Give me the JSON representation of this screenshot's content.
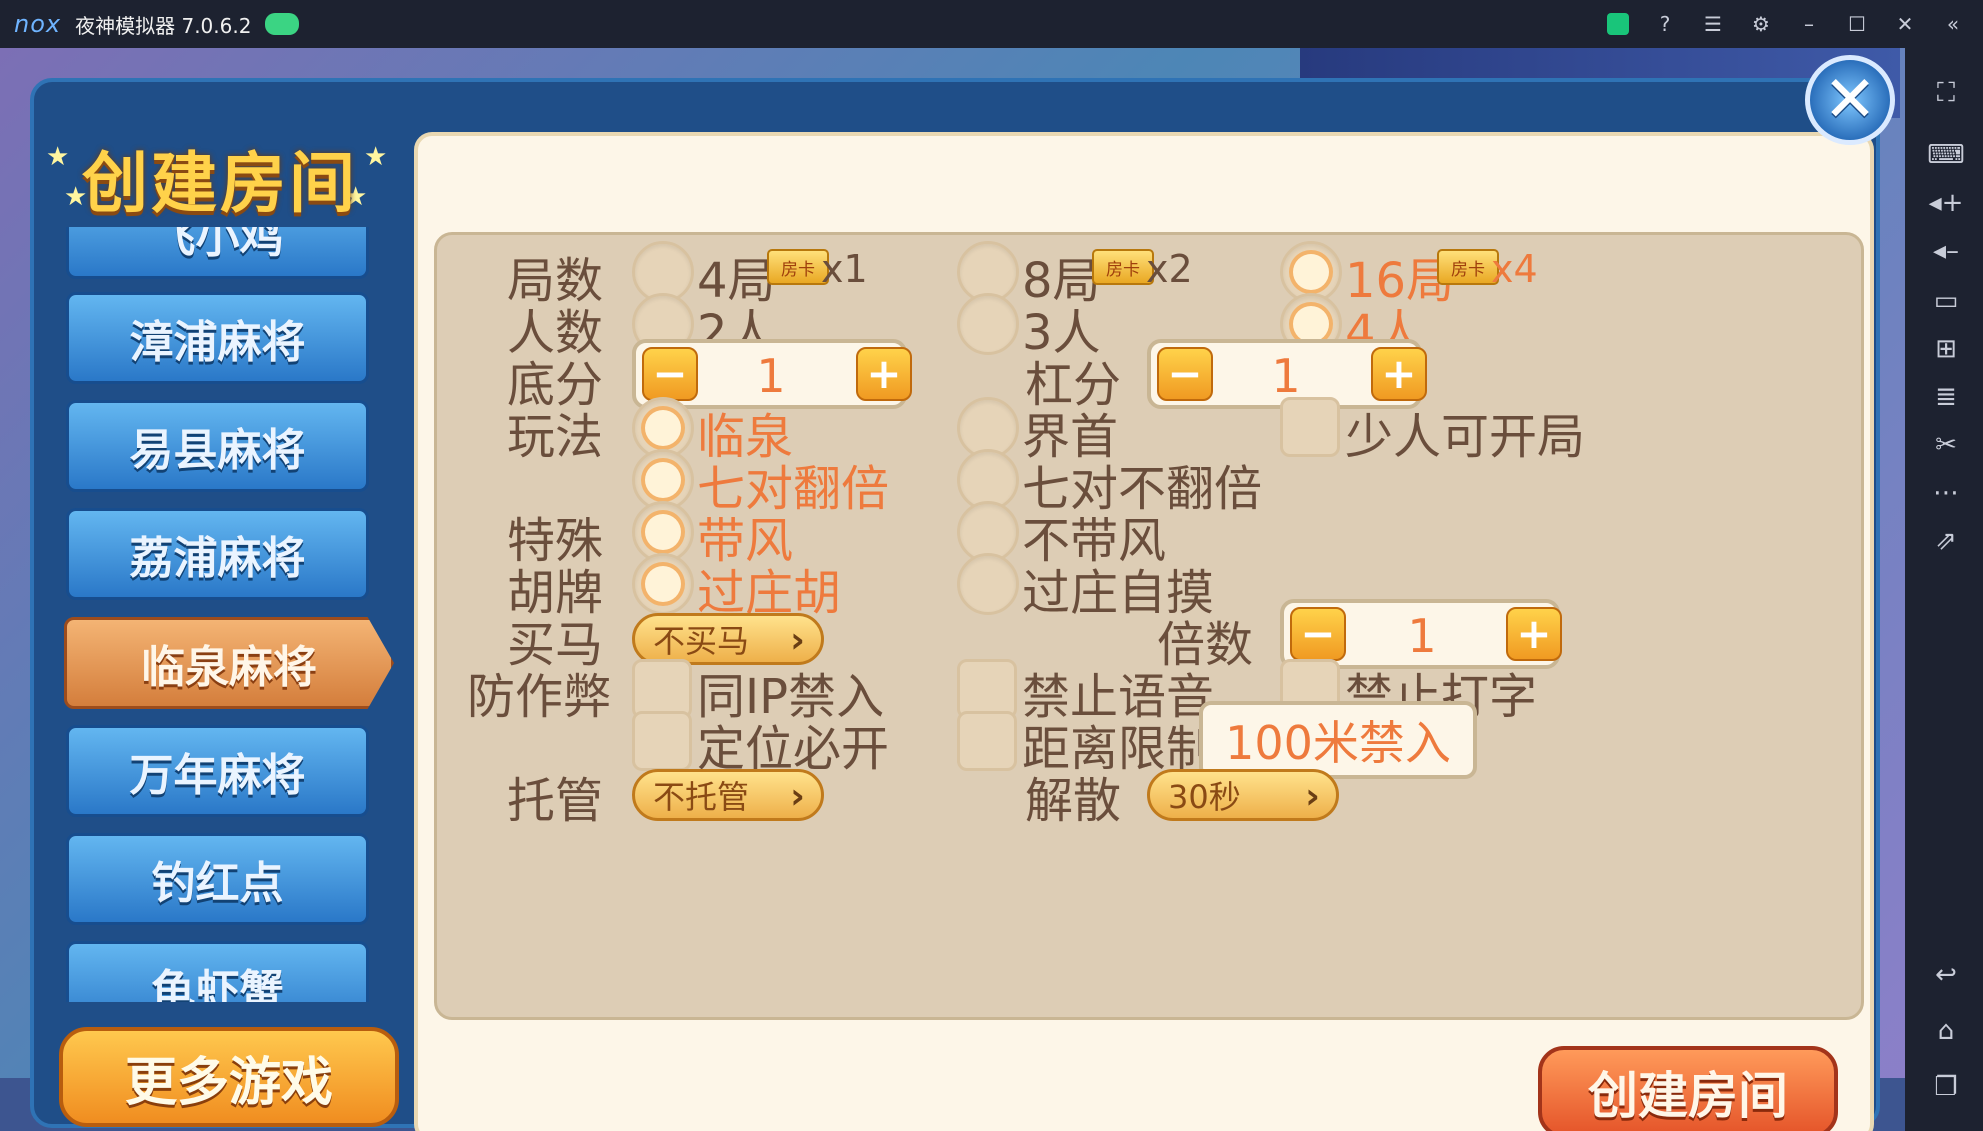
{
  "window": {
    "logo": "nox",
    "title": "夜神模拟器 7.0.6.2"
  },
  "titlebar_icons": [
    "gamepad-icon",
    "store-icon",
    "help-icon",
    "menu-icon",
    "settings-icon",
    "minimize-icon",
    "maximize-icon",
    "close-icon",
    "collapse-icon"
  ],
  "sidebar_icons": [
    "fullscreen-icon",
    "keyboard-icon",
    "volume-up-icon",
    "volume-down-icon",
    "screen-icon",
    "apk-icon",
    "stack-icon",
    "scissors-icon",
    "more-icon",
    "export-icon",
    "back-icon",
    "home-icon",
    "recent-icon"
  ],
  "dialog": {
    "title": "创建房间",
    "games": [
      "飞小鸡",
      "漳浦麻将",
      "易县麻将",
      "荔浦麻将",
      "临泉麻将",
      "万年麻将",
      "钓红点",
      "龟虾蟹"
    ],
    "active_game_index": 4,
    "more_games": "更多游戏",
    "create_button": "创建房间",
    "card_label": "房卡"
  },
  "form": {
    "rounds": {
      "label": "局数",
      "options": [
        {
          "text": "4局",
          "mult": "x1"
        },
        {
          "text": "8局",
          "mult": "x2"
        },
        {
          "text": "16局",
          "mult": "x4"
        }
      ],
      "selected": 2
    },
    "players": {
      "label": "人数",
      "options": [
        "2人",
        "3人",
        "4人"
      ],
      "selected": 2
    },
    "base_score": {
      "label": "底分",
      "value": "1"
    },
    "gang_score": {
      "label": "杠分",
      "value": "1"
    },
    "play": {
      "label": "玩法",
      "options": [
        "临泉",
        "界首"
      ],
      "selected": 0,
      "check": "少人可开局"
    },
    "double": {
      "options": [
        "七对翻倍",
        "七对不翻倍"
      ],
      "selected": 0
    },
    "special": {
      "label": "特殊",
      "options": [
        "带风",
        "不带风"
      ],
      "selected": 0
    },
    "hupai": {
      "label": "胡牌",
      "options": [
        "过庄胡",
        "过庄自摸"
      ],
      "selected": 0
    },
    "maima": {
      "label": "买马",
      "value": "不买马"
    },
    "multiplier": {
      "label": "倍数",
      "value": "1"
    },
    "anticheat": {
      "label": "防作弊",
      "checks": [
        "同IP禁入",
        "禁止语音",
        "禁止打字",
        "定位必开",
        "距离限制"
      ],
      "distance": "100米禁入"
    },
    "tuoguan": {
      "label": "托管",
      "value": "不托管"
    },
    "dissolve": {
      "label": "解散",
      "value": "30秒"
    }
  },
  "colors": {
    "selected": "#ee7a3d",
    "label": "#6a4e3c",
    "panel": "#fdf6e8",
    "inner": "#ddcdb5"
  }
}
